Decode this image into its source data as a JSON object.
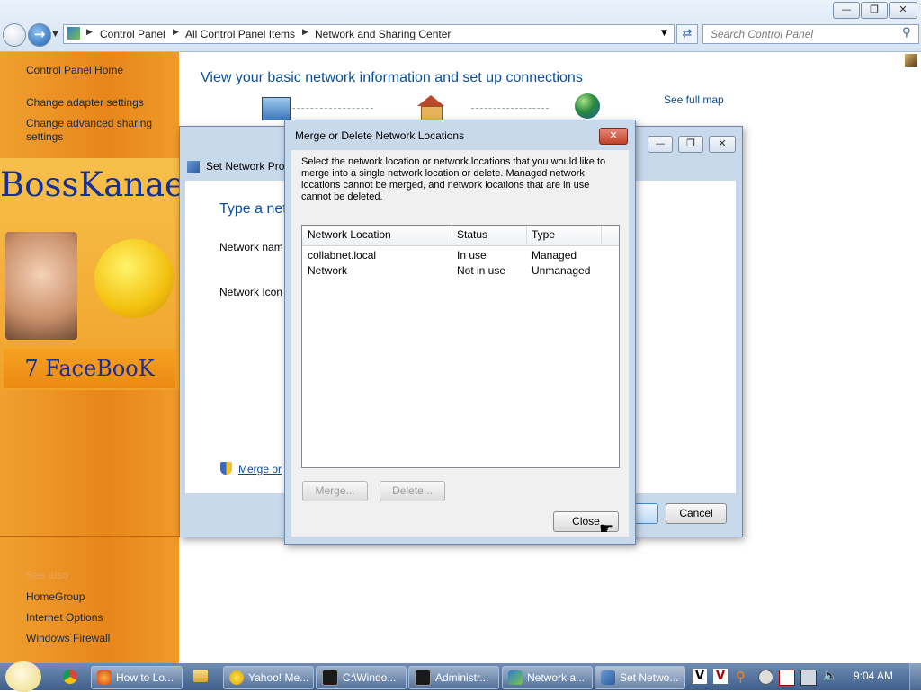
{
  "address": {
    "crumbs": [
      "Control Panel",
      "All Control Panel Items",
      "Network and Sharing Center"
    ],
    "search_placeholder": "Search Control Panel"
  },
  "leftnav": {
    "home": "Control Panel Home",
    "change_adapter": "Change adapter settings",
    "change_sharing_1": "Change advanced sharing",
    "change_sharing_2": "settings",
    "see_also": "See also",
    "homegroup": "HomeGroup",
    "internet_options": "Internet Options",
    "windows_firewall": "Windows Firewall"
  },
  "overlay": {
    "banner_title": "BossKanae",
    "banner_caption": "7 FaceBooK"
  },
  "main": {
    "heading": "View your basic network information and set up connections",
    "see_full_map": "See full map"
  },
  "set_network": {
    "title": "Set Network Prop",
    "heading": "Type a net",
    "network_name_label": "Network nam",
    "network_icon_label": "Network Icon",
    "merge_link": "Merge or",
    "cancel": "Cancel"
  },
  "dialog": {
    "title": "Merge or Delete Network Locations",
    "description": "Select the network location or network locations that you would like to merge into a single network location or delete. Managed network locations cannot be merged, and network locations that are in use cannot be deleted.",
    "columns": [
      "Network Location",
      "Status",
      "Type"
    ],
    "rows": [
      {
        "location": "collabnet.local",
        "status": "In use",
        "type": "Managed"
      },
      {
        "location": "Network",
        "status": "Not in use",
        "type": "Unmanaged"
      }
    ],
    "merge": "Merge...",
    "delete": "Delete...",
    "close": "Close"
  },
  "taskbar": {
    "items": [
      "How to Lo...",
      "Yahoo! Me...",
      "C:\\Windo...",
      "Administr...",
      "Network a...",
      "Set Netwo..."
    ],
    "clock": "9:04 AM"
  },
  "colors": {
    "accent_blue": "#0b4f9c",
    "link_blue": "#0e4a8b",
    "sidebar_orange": "#e8861a"
  }
}
